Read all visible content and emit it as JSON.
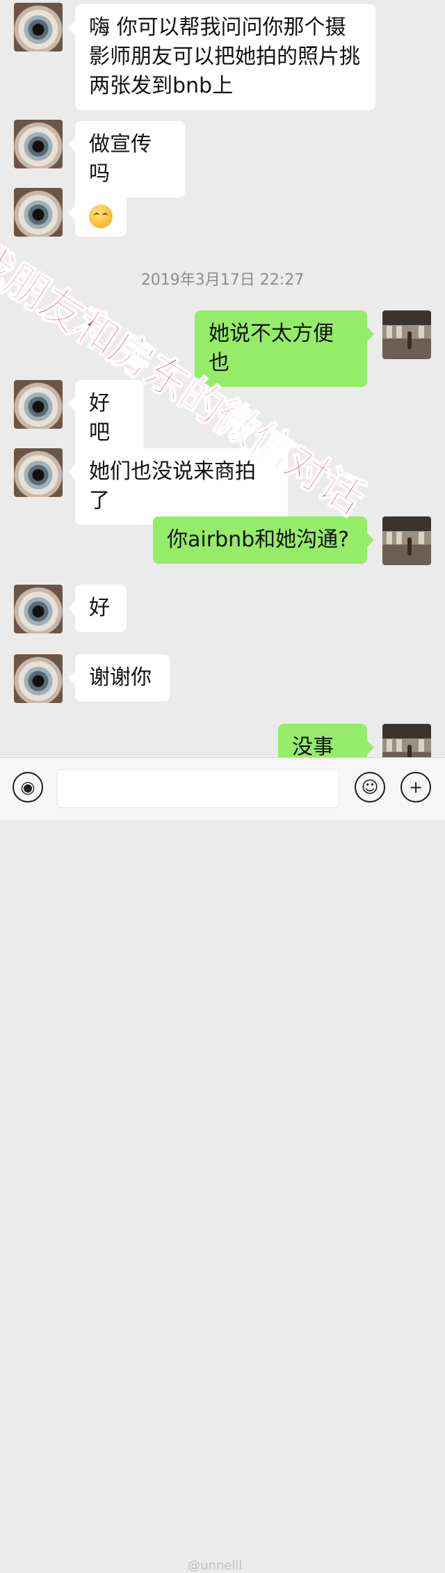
{
  "conversation": {
    "timestamp": "2019年3月17日 22:27",
    "messages": [
      {
        "side": "left",
        "text": "嗨 你可以帮我问问你那个摄影师朋友可以把她拍的照片挑两张发到bnb上"
      },
      {
        "side": "left",
        "text": "做宣传吗"
      },
      {
        "side": "left",
        "emoji": "smiling-face-emoji"
      },
      {
        "side": "right",
        "text": "她说不太方便也"
      },
      {
        "side": "left",
        "text": "好吧"
      },
      {
        "side": "left",
        "text": "她们也没说来商拍了"
      },
      {
        "side": "right",
        "text": "你airbnb和她沟通?"
      },
      {
        "side": "left",
        "text": "好"
      },
      {
        "side": "left",
        "text": "谢谢你"
      },
      {
        "side": "right",
        "text": "没事的"
      }
    ]
  },
  "overlay": {
    "watermark_text": "我朋友和房东的微信对话",
    "credit": "@unnelll",
    "watermark_color": "#ef3f83"
  },
  "input_bar": {
    "voice_icon": "voice-icon",
    "smile_icon": "emoji-icon",
    "plus_icon": "plus-icon",
    "input_value": ""
  },
  "colors": {
    "background": "#ebebeb",
    "sent_bubble": "#95ec69",
    "received_bubble": "#ffffff",
    "timestamp": "#8c8c8c"
  }
}
